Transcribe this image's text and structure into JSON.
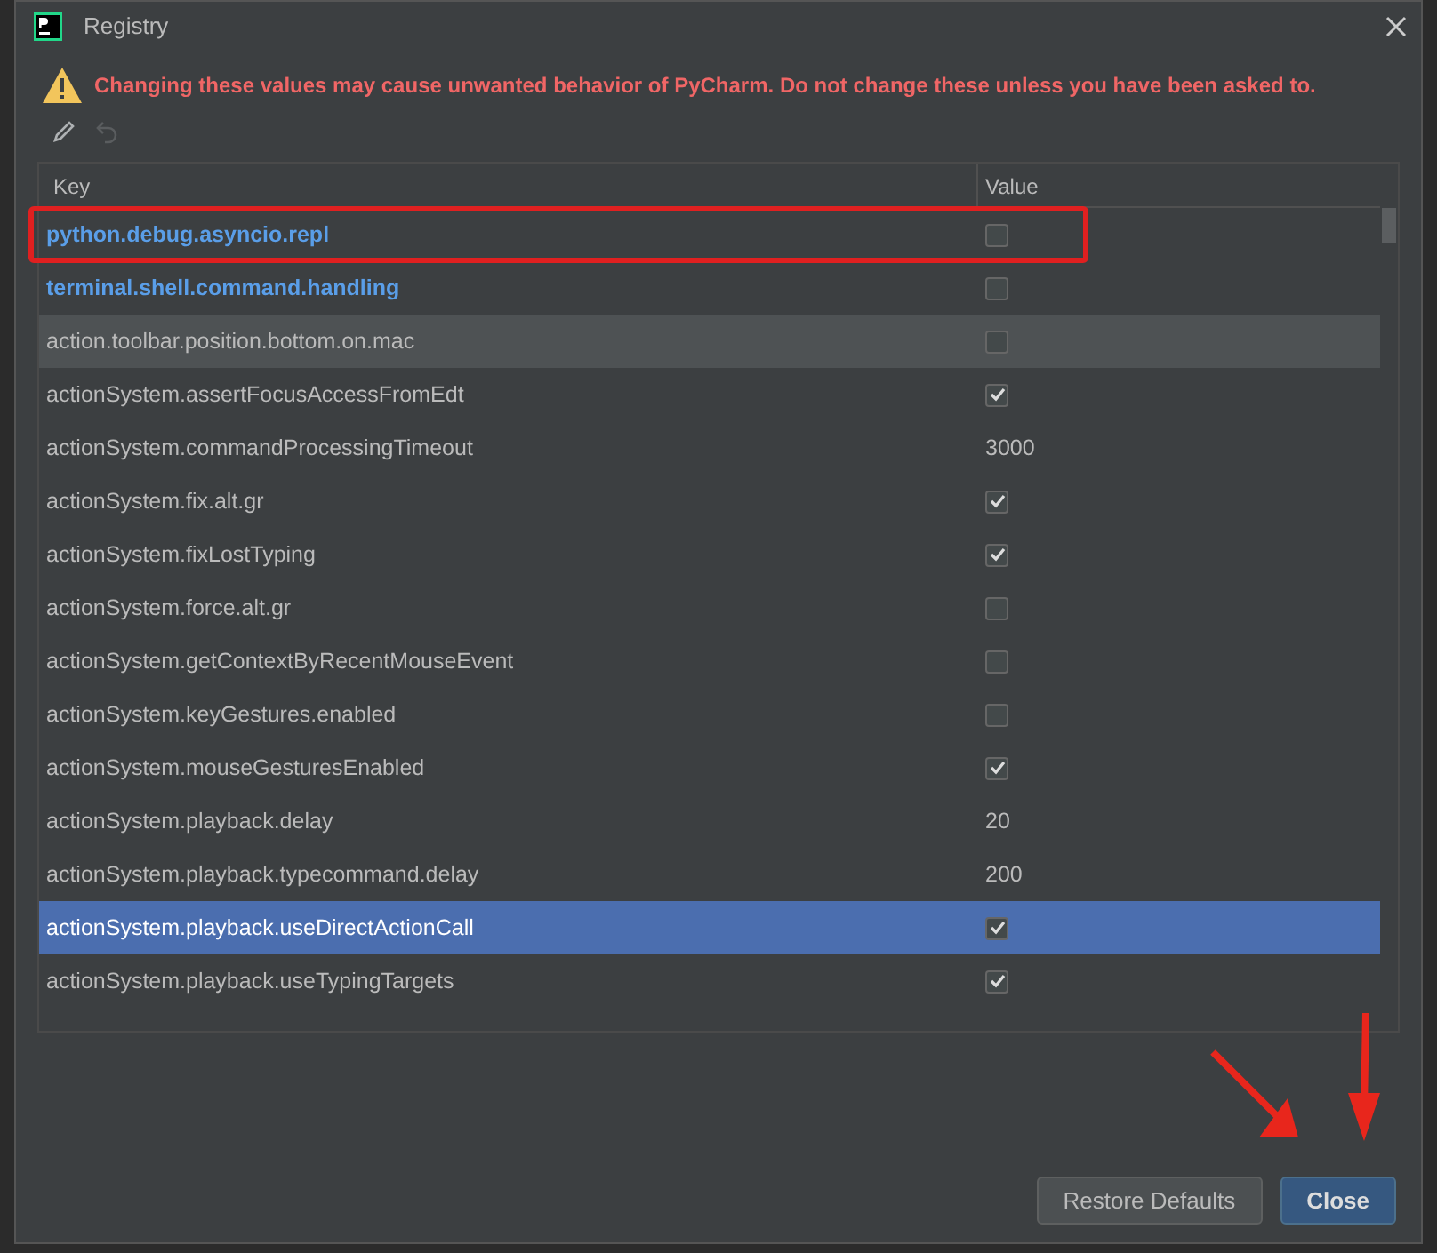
{
  "window": {
    "title": "Registry"
  },
  "warning": "Changing these values may cause unwanted behavior of PyCharm. Do not change these unless you have been asked to.",
  "toolbar": [
    {
      "kind": "edit",
      "disabled": false
    },
    {
      "kind": "revert",
      "disabled": true
    }
  ],
  "table": {
    "columns": [
      "Key",
      "Value"
    ],
    "rows": [
      {
        "key": "python.debug.asyncio.repl",
        "changed": true,
        "kind": "checkbox",
        "checked": false,
        "selected": false,
        "hovered": false,
        "annotated": true
      },
      {
        "key": "terminal.shell.command.handling",
        "changed": true,
        "kind": "checkbox",
        "checked": false,
        "selected": false,
        "hovered": false,
        "annotated": false
      },
      {
        "key": "action.toolbar.position.bottom.on.mac",
        "changed": false,
        "kind": "checkbox",
        "checked": false,
        "selected": false,
        "hovered": true,
        "annotated": false
      },
      {
        "key": "actionSystem.assertFocusAccessFromEdt",
        "changed": false,
        "kind": "checkbox",
        "checked": true,
        "selected": false,
        "hovered": false,
        "annotated": false
      },
      {
        "key": "actionSystem.commandProcessingTimeout",
        "changed": false,
        "kind": "text",
        "value": "3000",
        "selected": false,
        "hovered": false,
        "annotated": false
      },
      {
        "key": "actionSystem.fix.alt.gr",
        "changed": false,
        "kind": "checkbox",
        "checked": true,
        "selected": false,
        "hovered": false,
        "annotated": false
      },
      {
        "key": "actionSystem.fixLostTyping",
        "changed": false,
        "kind": "checkbox",
        "checked": true,
        "selected": false,
        "hovered": false,
        "annotated": false
      },
      {
        "key": "actionSystem.force.alt.gr",
        "changed": false,
        "kind": "checkbox",
        "checked": false,
        "selected": false,
        "hovered": false,
        "annotated": false
      },
      {
        "key": "actionSystem.getContextByRecentMouseEvent",
        "changed": false,
        "kind": "checkbox",
        "checked": false,
        "selected": false,
        "hovered": false,
        "annotated": false
      },
      {
        "key": "actionSystem.keyGestures.enabled",
        "changed": false,
        "kind": "checkbox",
        "checked": false,
        "selected": false,
        "hovered": false,
        "annotated": false
      },
      {
        "key": "actionSystem.mouseGesturesEnabled",
        "changed": false,
        "kind": "checkbox",
        "checked": true,
        "selected": false,
        "hovered": false,
        "annotated": false
      },
      {
        "key": "actionSystem.playback.delay",
        "changed": false,
        "kind": "text",
        "value": "20",
        "selected": false,
        "hovered": false,
        "annotated": false
      },
      {
        "key": "actionSystem.playback.typecommand.delay",
        "changed": false,
        "kind": "text",
        "value": "200",
        "selected": false,
        "hovered": false,
        "annotated": false
      },
      {
        "key": "actionSystem.playback.useDirectActionCall",
        "changed": false,
        "kind": "checkbox",
        "checked": true,
        "selected": true,
        "hovered": false,
        "annotated": false
      },
      {
        "key": "actionSystem.playback.useTypingTargets",
        "changed": false,
        "kind": "checkbox",
        "checked": true,
        "selected": false,
        "hovered": false,
        "annotated": false
      }
    ]
  },
  "buttons": [
    {
      "label": "Restore Defaults",
      "default": false
    },
    {
      "label": "Close",
      "default": true
    }
  ],
  "annotation_arrows": [
    {
      "kind": "diagonal"
    },
    {
      "kind": "vertical"
    }
  ]
}
